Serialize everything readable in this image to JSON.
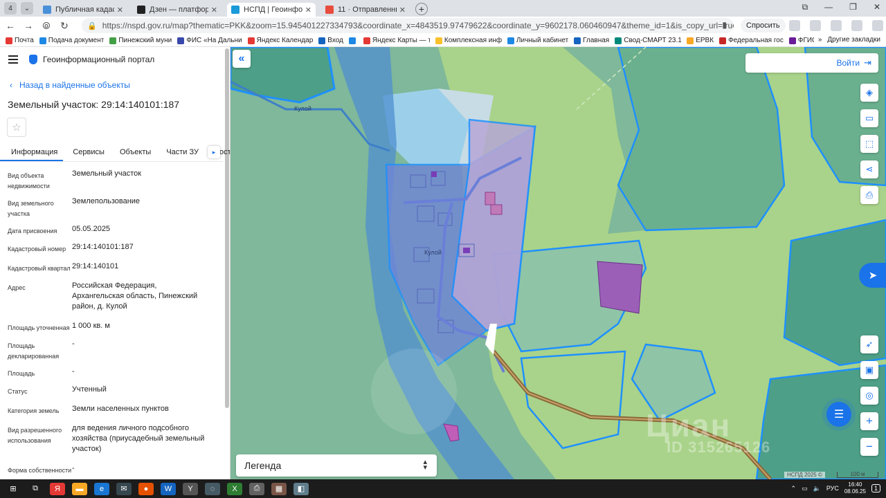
{
  "browser": {
    "tabs": [
      {
        "label": "Публичная кадастровая",
        "color": "#4a90d9",
        "active": false
      },
      {
        "label": "Дзен — платформа для п",
        "color": "#222222",
        "active": false
      },
      {
        "label": "НСПД | Геоинформаци",
        "color": "#1a9ad9",
        "active": true
      },
      {
        "label": "11 · Отправленные — Янд",
        "color": "#e84c3d",
        "active": false
      }
    ],
    "url": "https://nspd.gov.ru/map?thematic=PKK&zoom=15.945401227334793&coordinate_x=4843519.97479622&coordinate_y=9602178.060460947&theme_id=1&is_copy_url=true...",
    "ask_label": "Спросить",
    "bookmarks": [
      {
        "label": "Почта",
        "color": "#e53935"
      },
      {
        "label": "Подача документ",
        "color": "#1e88e5"
      },
      {
        "label": "Пинежский муни",
        "color": "#43a047"
      },
      {
        "label": "ФИС «На Дальни",
        "color": "#3949ab"
      },
      {
        "label": "Яндекс Календар",
        "color": "#e53935"
      },
      {
        "label": "Вход",
        "color": "#1565c0"
      },
      {
        "label": "",
        "color": "#1e88e5"
      },
      {
        "label": "Яндекс Карты — т",
        "color": "#e53935"
      },
      {
        "label": "Комплексная инф",
        "color": "#fbc02d"
      },
      {
        "label": "Личный кабинет",
        "color": "#1e88e5"
      },
      {
        "label": "Главная",
        "color": "#1565c0"
      },
      {
        "label": "Свод-СМАРТ 23.1",
        "color": "#00897b"
      },
      {
        "label": "ЕРВК",
        "color": "#f9a825"
      },
      {
        "label": "Федеральная гос",
        "color": "#c62828"
      },
      {
        "label": "ФГИС П",
        "color": "#6a1b9a"
      }
    ],
    "other_bookmarks": "Другие закладки"
  },
  "panel": {
    "portal_title": "Геоинформационный портал",
    "back_link": "Назад в найденные объекты",
    "object_title": "Земельный участок: 29:14:140101:187",
    "tabs": [
      "Информация",
      "Сервисы",
      "Объекты",
      "Части ЗУ",
      "Соста"
    ],
    "properties": [
      {
        "key": "Вид объекта недвижимости",
        "value": "Земельный участок"
      },
      {
        "key": "Вид земельного участка",
        "value": "Землепользование"
      },
      {
        "key": "Дата присвоения",
        "value": "05.05.2025"
      },
      {
        "key": "Кадастровый номер",
        "value": "29:14:140101:187"
      },
      {
        "key": "Кадастровый квартал",
        "value": "29:14:140101"
      },
      {
        "key": "Адрес",
        "value": "Российская Федерация, Архангельская область, Пинежский район, д. Кулой"
      },
      {
        "key": "Площадь уточненная",
        "value": "1 000 кв. м"
      },
      {
        "key": "Площадь декларированная",
        "value": "-"
      },
      {
        "key": "Площадь",
        "value": "-"
      },
      {
        "key": "Статус",
        "value": "Учтенный"
      },
      {
        "key": "Категория земель",
        "value": "Земли населенных пунктов"
      },
      {
        "key": "Вид разрешенного использования",
        "value": "для ведения личного подсобного хозяйства (приусадебный земельный участок)"
      },
      {
        "key": "Форма собственности",
        "value": "-"
      }
    ]
  },
  "map": {
    "login": "Войти",
    "legend": "Легенда",
    "copyright": "НСПД 2025 ©",
    "scale": "100 м",
    "place_label_1": "Кулой",
    "place_label_2": "Кулой",
    "watermark_1": "Циан",
    "watermark_2": "ID 315265126",
    "tools": [
      "layers-icon",
      "ruler-icon",
      "select-area-icon",
      "share-icon",
      "print-icon"
    ],
    "bottom_tools": [
      "locate-icon",
      "pip-icon",
      "geo-icon",
      "zoom-in-icon",
      "zoom-out-icon"
    ]
  },
  "taskbar": {
    "lang": "РУС",
    "time": "16:40",
    "date": "08.06.25",
    "notif": "1"
  }
}
